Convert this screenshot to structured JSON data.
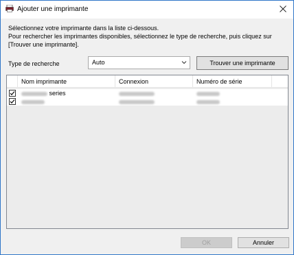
{
  "window": {
    "title": "Ajouter une imprimante",
    "close_icon": "close-icon",
    "app_icon": "printer-icon",
    "accent_color": "#2f76c8"
  },
  "instructions": [
    "Sélectionnez votre imprimante dans la liste ci-dessous.",
    "Pour rechercher les imprimantes disponibles, sélectionnez le type de recherche, puis cliquez sur",
    "[Trouver une imprimante]."
  ],
  "search": {
    "label": "Type de recherche",
    "selected": "Auto",
    "find_button": "Trouver une imprimante"
  },
  "table": {
    "columns": [
      "Nom imprimante",
      "Connexion",
      "Numéro de série"
    ],
    "rows": [
      {
        "checked": true,
        "name_suffix": "series"
      },
      {
        "checked": true,
        "name_suffix": ""
      }
    ]
  },
  "footer": {
    "ok_label": "OK",
    "ok_enabled": false,
    "cancel_label": "Annuler"
  }
}
